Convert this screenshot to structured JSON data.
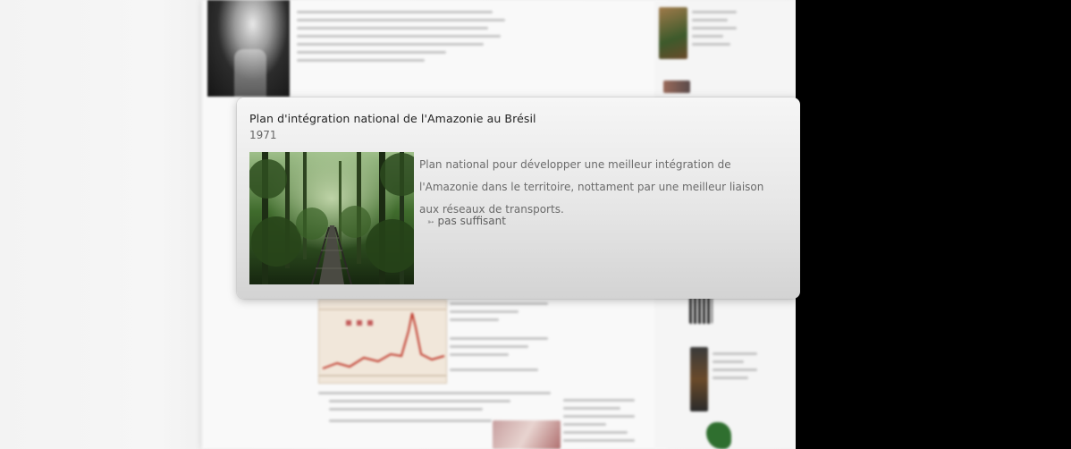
{
  "popup": {
    "title": "Plan d'intégration national de l'Amazonie au Brésil",
    "year": "1971",
    "image_alt": "forest-boardwalk-photo",
    "description": "Plan national pour développer une meilleur intégration de l'Amazonie dans le territoire, nottament par une meilleur liaison aux réseaux de transports.",
    "link_icon": "arrow-right-icon",
    "link_label": "pas suffisant"
  }
}
